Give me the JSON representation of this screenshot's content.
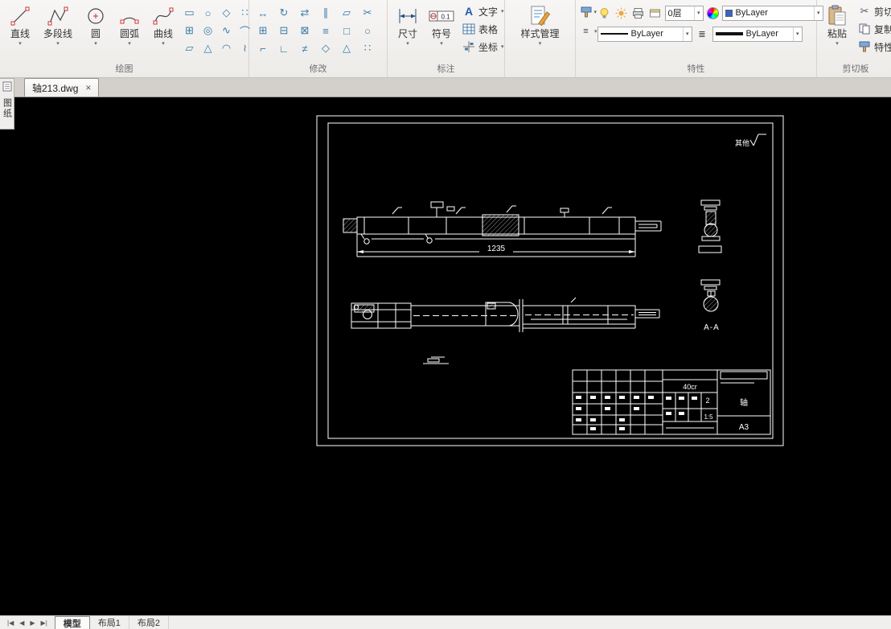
{
  "glyphs": {
    "dropdown": "▾",
    "close": "×",
    "menu": "≡",
    "hatch_lines": "≣",
    "scissors": "✂",
    "nav_first": "|◀",
    "nav_prev": "◀",
    "nav_next": "▶",
    "nav_last": "▶|"
  },
  "ribbon": {
    "draw": {
      "label": "绘图",
      "buttons": [
        {
          "label": "直线"
        },
        {
          "label": "多段线"
        },
        {
          "label": "圆"
        },
        {
          "label": "圆弧"
        },
        {
          "label": "曲线"
        }
      ],
      "grid": [
        "▭",
        "○",
        "◇",
        "∷",
        "⊞",
        "◎",
        "∿",
        "⌒",
        "▱",
        "△",
        "◠",
        "≀"
      ]
    },
    "modify": {
      "label": "修改",
      "grid": [
        "↔",
        "↻",
        "⇄",
        "∥",
        "▱",
        "✂",
        "⊞",
        "⊟",
        "⊠",
        "≡",
        "□",
        "○",
        "⌐",
        "∟",
        "≠",
        "◇",
        "△",
        "∷"
      ]
    },
    "annotate": {
      "label": "标注",
      "dim_label": "尺寸",
      "symbol_label": "符号",
      "symbol_badge": "0.1",
      "text_label": "文字",
      "text_glyph": "A",
      "table_label": "表格",
      "coord_label": "坐标"
    },
    "style_manager": {
      "label": "样式管理"
    },
    "properties": {
      "label": "特性",
      "layer_value": "0层",
      "color_value": "ByLayer",
      "linetype_value": "ByLayer",
      "lineweight_value": "ByLayer"
    },
    "clipboard": {
      "label": "剪切板",
      "paste_label": "粘贴",
      "cut_label": "剪切",
      "copy_label": "复制",
      "prop_label": "特性"
    }
  },
  "doc_tab": {
    "title": "轴213.dwg"
  },
  "side_tab": {
    "label": "图纸"
  },
  "drawing": {
    "finish_note": "其他",
    "dim_total": "1235",
    "section_label": "A-A",
    "title_block": {
      "material": "40cr",
      "qty": "2",
      "scale": "1:5",
      "part": "轴",
      "sheet": "A3"
    }
  },
  "nav_tabs": {
    "model": "模型",
    "layout1": "布局1",
    "layout2": "布局2"
  }
}
